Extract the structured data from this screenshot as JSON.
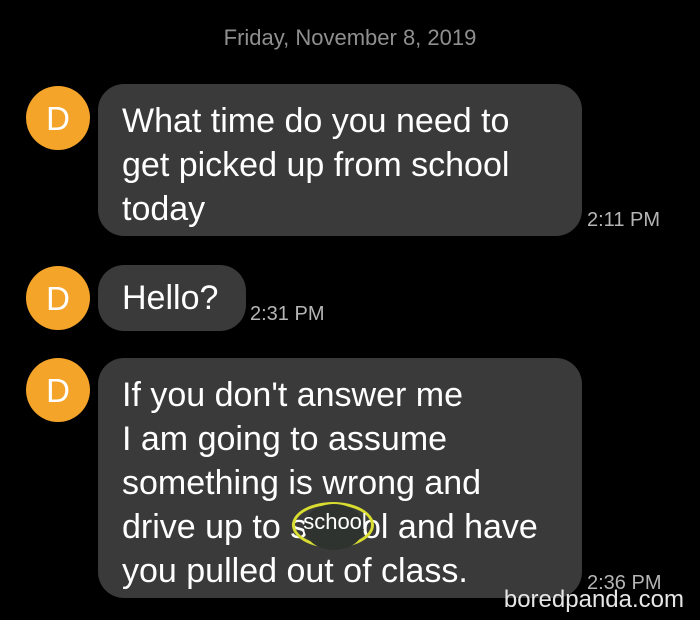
{
  "conversation": {
    "date_header": "Friday, November 8, 2019",
    "messages": [
      {
        "sender_initial": "D",
        "lines": [
          "What time do you need to",
          "get picked up from school",
          "today"
        ],
        "time": "2:11 PM"
      },
      {
        "sender_initial": "D",
        "lines": [
          "Hello?"
        ],
        "time": "2:31 PM"
      },
      {
        "sender_initial": "D",
        "lines": [
          "If you don't answer me",
          "I am going to assume",
          "something is wrong and",
          "drive up to school and have",
          "you pulled out of class."
        ],
        "time": "2:36 PM"
      }
    ],
    "sticker_text": "school"
  },
  "watermark": "boredpanda.com",
  "colors": {
    "avatar": "#f5a42a",
    "bubble": "#3a3a3a",
    "background": "#000000",
    "sticker_outline": "#d8dd30"
  }
}
